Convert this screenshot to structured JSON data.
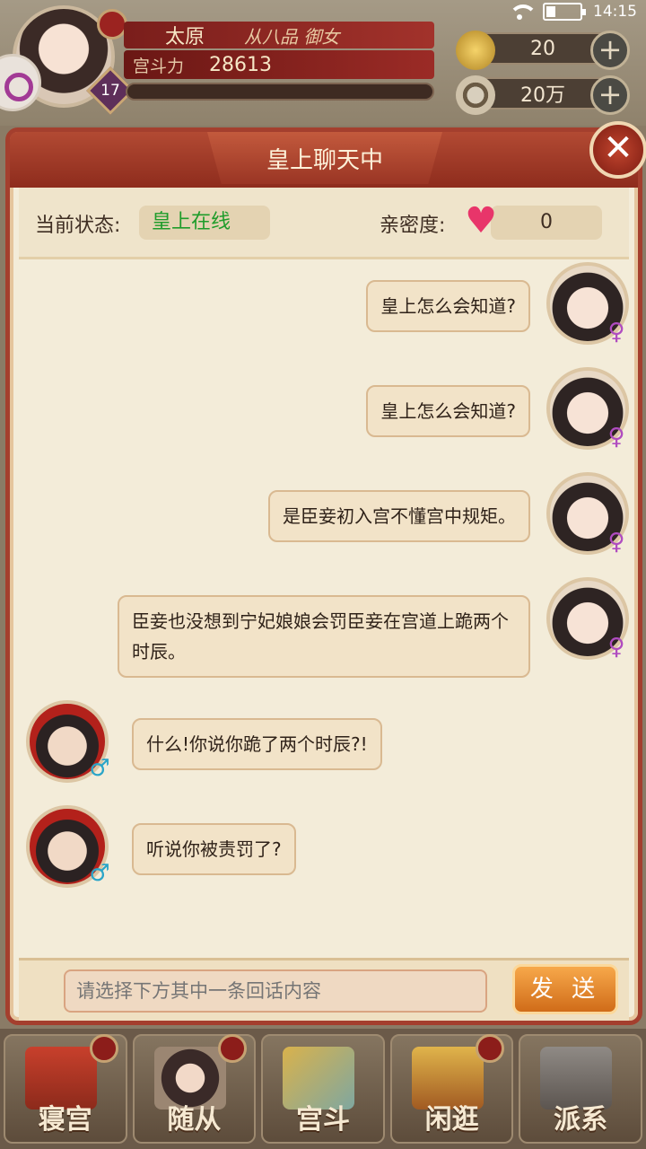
{
  "status_bar": {
    "time": "14:15"
  },
  "player": {
    "name": "太原",
    "title": "从八品  御女",
    "power_label": "宫斗力",
    "power_value": "28613",
    "level": "17"
  },
  "currencies": [
    {
      "name": "gold-ingot",
      "value": "20"
    },
    {
      "name": "copper-coin",
      "value": "20万"
    }
  ],
  "dialog": {
    "title": "皇上聊天中",
    "state_label": "当前状态:",
    "state_value": "皇上在线",
    "intimacy_label": "亲密度:",
    "intimacy_value": "0",
    "messages": [
      {
        "speaker": "player",
        "text": "皇上怎么会知道?"
      },
      {
        "speaker": "player",
        "text": "皇上怎么会知道?"
      },
      {
        "speaker": "player",
        "text": "是臣妾初入宫不懂宫中规矩。"
      },
      {
        "speaker": "player",
        "text": "臣妾也没想到宁妃娘娘会罚臣妾在宫道上跪两个时辰。"
      },
      {
        "speaker": "emperor",
        "text": "什么!你说你跪了两个时辰?!"
      },
      {
        "speaker": "emperor",
        "text": "听说你被责罚了?"
      }
    ],
    "input_placeholder": "请选择下方其中一条回话内容",
    "send_label": "发 送",
    "female_symbol": "♀",
    "male_symbol": "♂"
  },
  "bottom_nav": [
    {
      "label": "寝宫"
    },
    {
      "label": "随从"
    },
    {
      "label": "宫斗"
    },
    {
      "label": "闲逛"
    },
    {
      "label": "派系"
    }
  ],
  "colors": {
    "online_green": "#1e9c2a",
    "dialog_red": "#a43f2e",
    "bubble_bg": "#f2e3c8"
  }
}
